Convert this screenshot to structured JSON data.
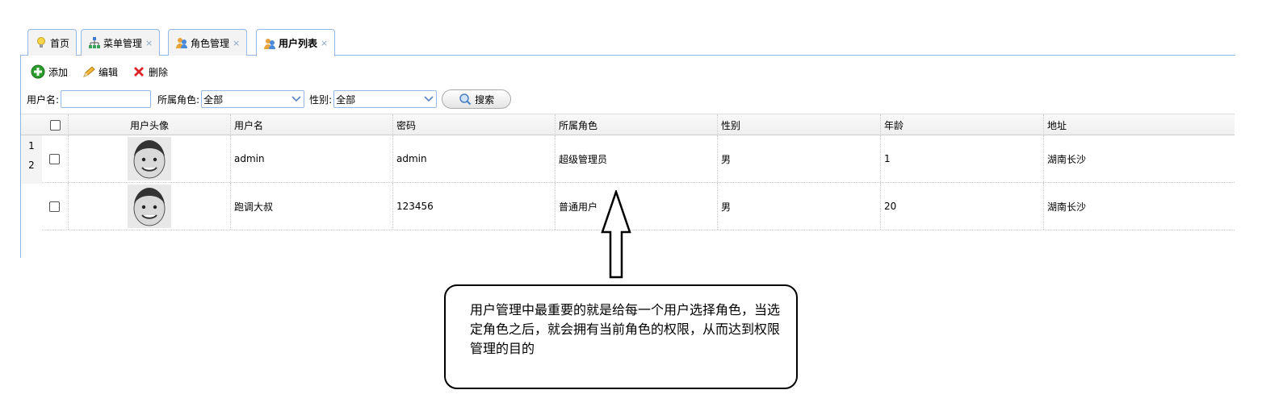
{
  "tabs": [
    {
      "label": "首页",
      "icon": "lightbulb-icon",
      "closable": false,
      "active": false
    },
    {
      "label": "菜单管理",
      "icon": "tree-menu-icon",
      "closable": true,
      "active": false
    },
    {
      "label": "角色管理",
      "icon": "role-group-icon",
      "closable": true,
      "active": false
    },
    {
      "label": "用户列表",
      "icon": "user-group-icon",
      "closable": true,
      "active": true
    }
  ],
  "close_glyph": "×",
  "toolbar": {
    "add_label": "添加",
    "edit_label": "编辑",
    "delete_label": "删除"
  },
  "filters": {
    "username_label": "用户名:",
    "username_value": "",
    "role_label": "所属角色:",
    "role_value": "全部",
    "gender_label": "性别:",
    "gender_value": "全部",
    "search_label": "搜索"
  },
  "grid": {
    "columns": [
      "用户头像",
      "用户名",
      "密码",
      "所属角色",
      "性别",
      "年龄",
      "地址"
    ],
    "row_numbers": [
      "1",
      "2"
    ],
    "rows": [
      {
        "username": "admin",
        "password": "admin",
        "role": "超级管理员",
        "gender": "男",
        "age": "1",
        "address": "湖南长沙"
      },
      {
        "username": "跑调大叔",
        "password": "123456",
        "role": "普通用户",
        "gender": "男",
        "age": "20",
        "address": "湖南长沙"
      }
    ]
  },
  "annotation": {
    "text": "用户管理中最重要的就是给每一个用户选择角色，当选定角色之后，就会拥有当前角色的权限，从而达到权限管理的目的"
  },
  "colors": {
    "border_blue": "#95b8e7",
    "add_green": "#2a9d2a",
    "delete_red": "#d9262b"
  }
}
